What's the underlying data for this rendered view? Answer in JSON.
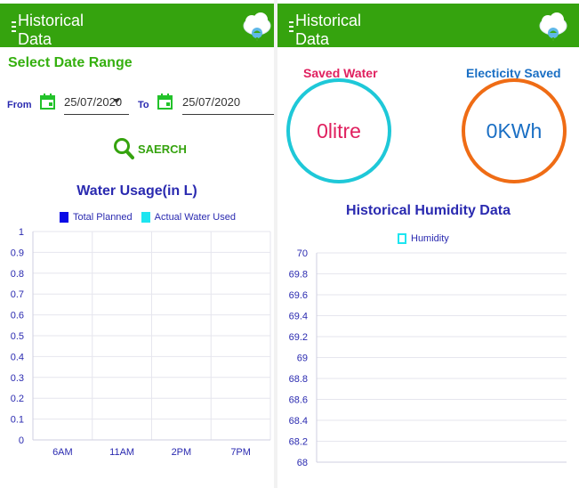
{
  "left_screen": {
    "appbar": {
      "title": "Historical Data"
    },
    "section_title": "Select Date Range",
    "from_label": "From",
    "to_label": "To",
    "from_date": "25/07/2020",
    "to_date": "25/07/2020",
    "search_label": "SAERCH",
    "chart_title": "Water Usage(in L)",
    "legend": [
      "Total Planned",
      "Actual Water Used"
    ]
  },
  "right_screen": {
    "appbar": {
      "title": "Historical Data"
    },
    "saved_water_label": "Saved Water",
    "saved_water_value": "0litre",
    "electricity_label": "Electicity Saved",
    "electricity_value": "0KWh",
    "chart_title": "Historical Humidity Data",
    "legend": [
      "Humidity"
    ]
  },
  "colors": {
    "appbar": "#35a30e",
    "accent_green": "#35b00f",
    "navy": "#2a2ab0",
    "pink": "#e0205f",
    "blue": "#1a6fc4",
    "cyan": "#1ec8d8",
    "orange": "#ef6c15",
    "planned": "#0a0ae6",
    "actual": "#1ee5f0"
  },
  "icons": [
    "menu-icon",
    "cloud-icon",
    "calendar-icon",
    "search-icon",
    "chevron-down-icon"
  ],
  "chart_data": [
    {
      "type": "bar",
      "title": "Water Usage(in L)",
      "categories": [
        "6AM",
        "11AM",
        "2PM",
        "7PM"
      ],
      "series": [
        {
          "name": "Total Planned",
          "values": [
            0,
            0,
            0,
            0
          ]
        },
        {
          "name": "Actual Water Used",
          "values": [
            0,
            0,
            0,
            0
          ]
        }
      ],
      "ylim": [
        0,
        1
      ],
      "yticks": [
        "0",
        "0.1",
        "0.2",
        "0.3",
        "0.4",
        "0.5",
        "0.6",
        "0.7",
        "0.8",
        "0.9",
        "1"
      ],
      "grid": true,
      "legend": "top-center"
    },
    {
      "type": "line",
      "title": "Historical Humidity Data",
      "series": [
        {
          "name": "Humidity",
          "values": []
        }
      ],
      "ylim": [
        68,
        70
      ],
      "yticks": [
        "68",
        "68.2",
        "68.4",
        "68.6",
        "68.8",
        "69",
        "69.2",
        "69.4",
        "69.6",
        "69.8",
        "70"
      ],
      "grid": true,
      "legend": "top-center"
    }
  ]
}
